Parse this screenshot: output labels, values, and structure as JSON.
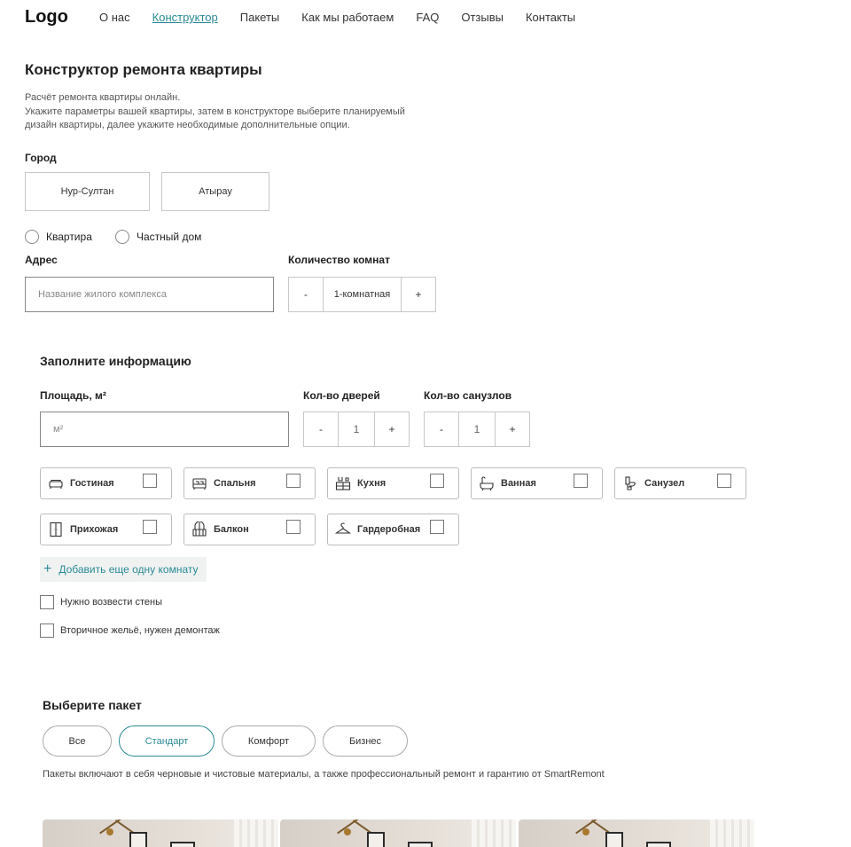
{
  "header": {
    "logo": "Logo",
    "nav": [
      "О нас",
      "Конструктор",
      "Пакеты",
      "Как мы работаем",
      "FAQ",
      "Отзывы",
      "Контакты"
    ]
  },
  "page": {
    "title": "Конструктор ремонта квартиры",
    "intro": [
      "Расчёт ремонта квартиры онлайн.",
      "Укажите параметры вашей квартиры, затем в конструкторе выберите планируемый",
      "дизайн квартиры, далее укажите необходимые дополнительные опции."
    ]
  },
  "city": {
    "label": "Город",
    "options": [
      "Нур-Султан",
      "Атырау"
    ]
  },
  "property": {
    "options": [
      "Квартира",
      "Частный дом"
    ]
  },
  "address": {
    "label": "Адрес",
    "placeholder": "Название жилого комплекса"
  },
  "rooms_count": {
    "label": "Количество комнат",
    "minus": "-",
    "value": "1-комнатная",
    "plus": "+"
  },
  "info": {
    "title": "Заполните информацию",
    "area_label": "Площадь, м²",
    "area_placeholder": "м²",
    "doors_label": "Кол-во дверей",
    "doors_value": "1",
    "bathrooms_label": "Кол-во санузлов",
    "bathrooms_value": "1",
    "minus": "-",
    "plus": "+"
  },
  "rooms": [
    {
      "label": "Гостиная",
      "icon": "sofa-icon"
    },
    {
      "label": "Спальня",
      "icon": "bed-icon"
    },
    {
      "label": "Кухня",
      "icon": "kitchen-icon"
    },
    {
      "label": "Ванная",
      "icon": "bathtub-icon"
    },
    {
      "label": "Санузел",
      "icon": "toilet-icon"
    },
    {
      "label": "Прихожая",
      "icon": "wardrobe-icon"
    },
    {
      "label": "Балкон",
      "icon": "balcony-icon"
    },
    {
      "label": "Гардеробная",
      "icon": "hanger-icon"
    }
  ],
  "add_room": {
    "plus": "+",
    "label": "Добавить еще одну комнату"
  },
  "options": [
    "Нужно возвести стены",
    "Вторичное жельё, нужен демонтаж"
  ],
  "packages": {
    "title": "Выберите пакет",
    "tabs": [
      "Все",
      "Стандарт",
      "Комфорт",
      "Бизнес"
    ],
    "selected": "Стандарт",
    "note": "Пакеты включают в себя черновые и чистовые материалы, а также профессиональный ремонт и гарантию от SmartRemont"
  },
  "colors": {
    "accent": "#2a8a95"
  }
}
